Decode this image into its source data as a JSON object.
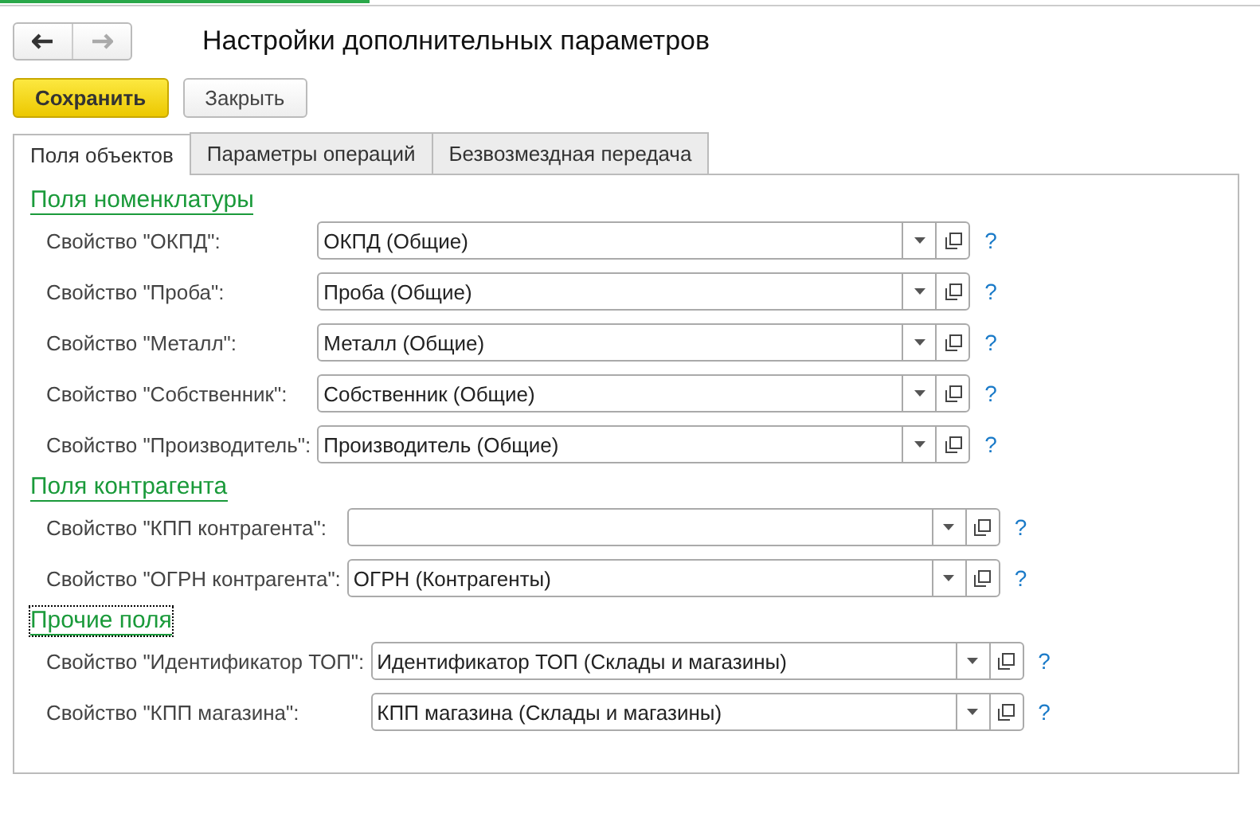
{
  "window": {
    "title": "Настройки дополнительных параметров"
  },
  "toolbar": {
    "buttons": [
      {
        "label": "Сохранить",
        "kind": "primary"
      },
      {
        "label": "Закрыть",
        "kind": "plain"
      }
    ]
  },
  "tabs": [
    {
      "label": "Поля объектов",
      "selected": true
    },
    {
      "label": "Параметры операций",
      "selected": false
    },
    {
      "label": "Безвозмездная передача",
      "selected": false
    }
  ],
  "groups": [
    {
      "title": "Поля номенклатуры",
      "focused": false,
      "fields": [
        {
          "label": "Свойство \"ОКПД\":",
          "value": "ОКПД (Общие)",
          "help": "?"
        },
        {
          "label": "Свойство \"Проба\":",
          "value": "Проба (Общие)",
          "help": "?"
        },
        {
          "label": "Свойство \"Металл\":",
          "value": "Металл (Общие)",
          "help": "?"
        },
        {
          "label": "Свойство \"Собственник\":",
          "value": "Собственник (Общие)",
          "help": "?"
        },
        {
          "label": "Свойство \"Производитель\":",
          "value": "Производитель (Общие)",
          "help": "?"
        }
      ]
    },
    {
      "title": "Поля контрагента",
      "focused": false,
      "fields": [
        {
          "label": "Свойство \"КПП контрагента\":",
          "help": "?"
        },
        {
          "label": "Свойство \"ОГРН контрагента\":",
          "value": "ОГРН (Контрагенты)",
          "help": "?"
        }
      ]
    },
    {
      "title": "Прочие поля",
      "focused": true,
      "fields": [
        {
          "label": "Свойство \"Идентификатор ТОП\":",
          "value": "Идентификатор ТОП (Склады и магазины)",
          "help": "?"
        },
        {
          "label": "Свойство \"КПП магазина\":",
          "value": "КПП магазина (Склады и магазины)",
          "help": "?"
        }
      ]
    }
  ]
}
